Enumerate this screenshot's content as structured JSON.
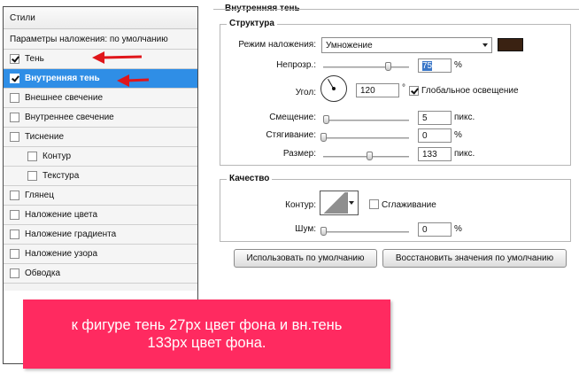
{
  "styles_panel": {
    "header": "Стили",
    "defaults_label": "Параметры наложения: по умолчанию",
    "items": [
      {
        "label": "Тень",
        "checked": true,
        "selected": false,
        "indent": false
      },
      {
        "label": "Внутренняя тень",
        "checked": true,
        "selected": true,
        "indent": false
      },
      {
        "label": "Внешнее свечение",
        "checked": false,
        "selected": false,
        "indent": false
      },
      {
        "label": "Внутреннее свечение",
        "checked": false,
        "selected": false,
        "indent": false
      },
      {
        "label": "Тиснение",
        "checked": false,
        "selected": false,
        "indent": false
      },
      {
        "label": "Контур",
        "checked": false,
        "selected": false,
        "indent": true
      },
      {
        "label": "Текстура",
        "checked": false,
        "selected": false,
        "indent": true
      },
      {
        "label": "Глянец",
        "checked": false,
        "selected": false,
        "indent": false
      },
      {
        "label": "Наложение цвета",
        "checked": false,
        "selected": false,
        "indent": false
      },
      {
        "label": "Наложение градиента",
        "checked": false,
        "selected": false,
        "indent": false
      },
      {
        "label": "Наложение узора",
        "checked": false,
        "selected": false,
        "indent": false
      },
      {
        "label": "Обводка",
        "checked": false,
        "selected": false,
        "indent": false
      }
    ]
  },
  "inner_shadow": {
    "section_title": "Внутренняя тень",
    "structure": {
      "legend": "Структура",
      "blend_mode_label": "Режим наложения:",
      "blend_mode_value": "Умножение",
      "color": "#3a2212",
      "opacity_label": "Непрозр.:",
      "opacity_value": "75",
      "opacity_unit": "%",
      "angle_label": "Угол:",
      "angle_value": "120",
      "angle_unit": "°",
      "global_light_label": "Глобальное освещение",
      "global_light_checked": true,
      "distance_label": "Смещение:",
      "distance_value": "5",
      "distance_unit": "пикс.",
      "choke_label": "Стягивание:",
      "choke_value": "0",
      "choke_unit": "%",
      "size_label": "Размер:",
      "size_value": "133",
      "size_unit": "пикс."
    },
    "quality": {
      "legend": "Качество",
      "contour_label": "Контур:",
      "antialias_label": "Сглаживание",
      "antialias_checked": false,
      "noise_label": "Шум:",
      "noise_value": "0",
      "noise_unit": "%"
    },
    "buttons": {
      "make_default": "Использовать по умолчанию",
      "reset_default": "Восстановить значения по умолчанию"
    }
  },
  "annotation": {
    "line1": "к фигуре тень 27px цвет фона и вн.тень",
    "line2": "133px цвет фона.",
    "arrow_color": "#e0161b",
    "banner_color": "#ff2a60"
  }
}
